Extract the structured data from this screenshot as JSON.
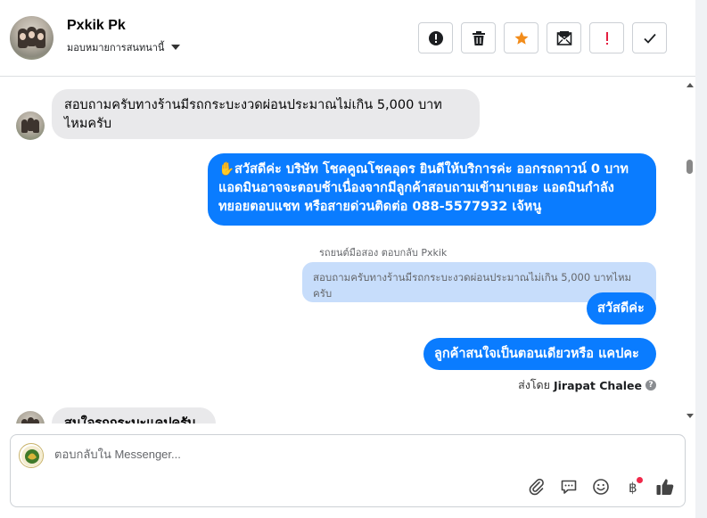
{
  "header": {
    "contact_name": "Pxkik Pk",
    "assign_label": "มอบหมายการสนทนานี้",
    "actions": [
      {
        "name": "mark-spam-button",
        "icon": "exclamation-circle-icon"
      },
      {
        "name": "delete-button",
        "icon": "trash-icon"
      },
      {
        "name": "star-button",
        "icon": "star-icon"
      },
      {
        "name": "mark-unread-button",
        "icon": "envelope-icon"
      },
      {
        "name": "follow-up-button",
        "icon": "exclamation-icon"
      },
      {
        "name": "mark-done-button",
        "icon": "checkmark-icon"
      }
    ]
  },
  "messages": {
    "m1": "สอบถามครับทางร้านมีรถกระบะงวดผ่อนประมาณไม่เกิน 5,000 บาท ไหมครับ",
    "m2": "✋สวัสดีค่ะ บริษัท โชคคูณโชคอุดร ยินดีให้บริการค่ะ ออกรถดาวน์ 0 บาท แอดมินอาจจะตอบช้าเนื่องจากมีลูกค้าสอบถามเข้ามาเยอะ แอดมินกำลังทยอยตอบแชท หรือสายด่วนติดต่อ 088-5577932 เจ้หนู",
    "reply_label": "รถยนต์มือสอง ตอบกลับ Pxkik",
    "quoted": "สอบถามครับทางร้านมีรถกระบะงวดผ่อนประมาณไม่เกิน 5,000 บาทไหมครับ",
    "m3": "สวัสดีค่ะ",
    "m4": "ลูกค้าสนใจเป็นตอนเดียวหรือ แคปคะ",
    "sent_by_prefix": "ส่งโดย",
    "sent_by_agent": "Jirapat Chalee",
    "m5": "สนใจรถกระบะแคปครับพี่"
  },
  "composer": {
    "placeholder": "ตอบกลับใน Messenger...",
    "tools": [
      "paperclip-icon",
      "saved-reply-icon",
      "emoji-icon",
      "baht-payment-icon",
      "thumbs-up-icon"
    ]
  },
  "colors": {
    "outgoing": "#0a7cff",
    "incoming": "#e9e9eb",
    "quoted": "#c7ddfb",
    "star": "#f28c1a",
    "alert": "#e41e3f"
  }
}
